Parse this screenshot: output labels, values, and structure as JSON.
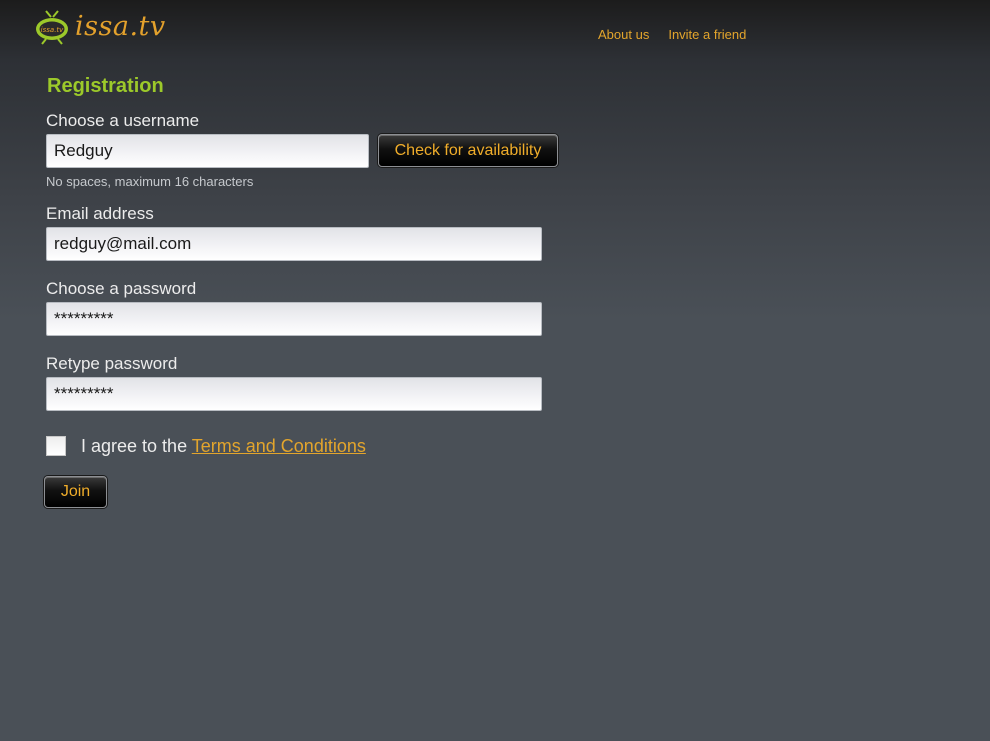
{
  "brand": {
    "logo_text": "issa.tv",
    "logo_badge": "issa.tv",
    "accent": "#e3a12c",
    "title_color": "#9cc92a"
  },
  "nav": {
    "about": "About us",
    "invite": "Invite a friend"
  },
  "form": {
    "title": "Registration",
    "username": {
      "label": "Choose a username",
      "value": "Redguy",
      "hint": "No spaces, maximum 16 characters",
      "check_button": "Check for availability"
    },
    "email": {
      "label": "Email address",
      "value": "redguy@mail.com"
    },
    "password": {
      "label": "Choose a password",
      "value": "*********"
    },
    "retype": {
      "label": "Retype password",
      "value": "*********"
    },
    "terms": {
      "prefix": "I agree to the",
      "link": "Terms and Conditions",
      "checked": false
    },
    "join_button": "Join"
  }
}
